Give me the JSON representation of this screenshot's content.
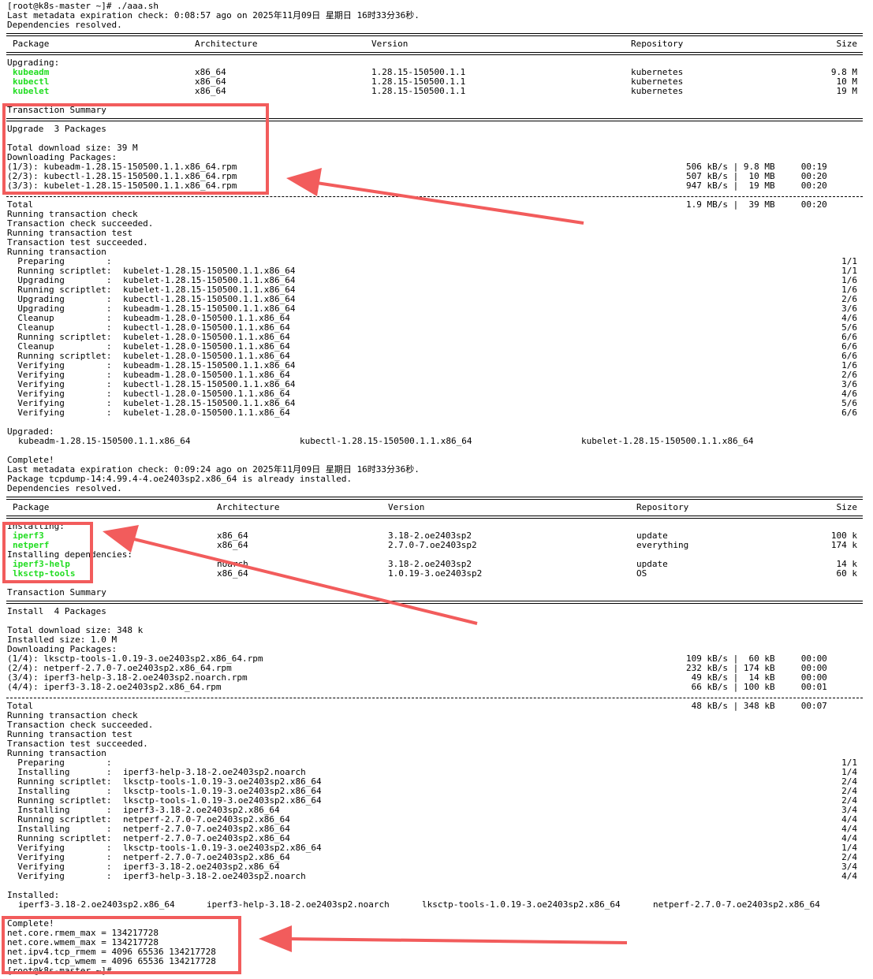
{
  "prompt": "[root@k8s-master ~]# ./aaa.sh",
  "meta1": "Last metadata expiration check: 0:08:57 ago on 2025年11月09日 星期日 16时33分36秒.",
  "deps_resolved": "Dependencies resolved.",
  "headers": {
    "package": "Package",
    "arch": "Architecture",
    "version": "Version",
    "repo": "Repository",
    "size": "Size"
  },
  "upgrading_label": "Upgrading:",
  "upgrade_pkgs": [
    {
      "name": "kubeadm",
      "arch": "x86_64",
      "version": "1.28.15-150500.1.1",
      "repo": "kubernetes",
      "size": "9.8 M"
    },
    {
      "name": "kubectl",
      "arch": "x86_64",
      "version": "1.28.15-150500.1.1",
      "repo": "kubernetes",
      "size": "10 M"
    },
    {
      "name": "kubelet",
      "arch": "x86_64",
      "version": "1.28.15-150500.1.1",
      "repo": "kubernetes",
      "size": "19 M"
    }
  ],
  "txn_summary": "Transaction Summary",
  "upgrade_count": "Upgrade  3 Packages",
  "total_dl1": "Total download size: 39 M",
  "downloading": "Downloading Packages:",
  "dl1": [
    {
      "file": "(1/3): kubeadm-1.28.15-150500.1.1.x86_64.rpm",
      "rate": "506 kB/s | 9.8 MB     00:19"
    },
    {
      "file": "(2/3): kubectl-1.28.15-150500.1.1.x86_64.rpm",
      "rate": "507 kB/s |  10 MB     00:20"
    },
    {
      "file": "(3/3): kubelet-1.28.15-150500.1.1.x86_64.rpm",
      "rate": "947 kB/s |  19 MB     00:20"
    }
  ],
  "total_label": "Total",
  "total1_rate": "1.9 MB/s |  39 MB     00:20",
  "txn_lines": [
    "Running transaction check",
    "Transaction check succeeded.",
    "Running transaction test",
    "Transaction test succeeded.",
    "Running transaction"
  ],
  "steps1": [
    {
      "action": "  Preparing        :",
      "pkg": "",
      "prog": "1/1"
    },
    {
      "action": "  Running scriptlet:",
      "pkg": "kubelet-1.28.15-150500.1.1.x86_64",
      "prog": "1/1"
    },
    {
      "action": "  Upgrading        :",
      "pkg": "kubelet-1.28.15-150500.1.1.x86_64",
      "prog": "1/6"
    },
    {
      "action": "  Running scriptlet:",
      "pkg": "kubelet-1.28.15-150500.1.1.x86_64",
      "prog": "1/6"
    },
    {
      "action": "  Upgrading        :",
      "pkg": "kubectl-1.28.15-150500.1.1.x86_64",
      "prog": "2/6"
    },
    {
      "action": "  Upgrading        :",
      "pkg": "kubeadm-1.28.15-150500.1.1.x86_64",
      "prog": "3/6"
    },
    {
      "action": "  Cleanup          :",
      "pkg": "kubeadm-1.28.0-150500.1.1.x86_64",
      "prog": "4/6"
    },
    {
      "action": "  Cleanup          :",
      "pkg": "kubectl-1.28.0-150500.1.1.x86_64",
      "prog": "5/6"
    },
    {
      "action": "  Running scriptlet:",
      "pkg": "kubelet-1.28.0-150500.1.1.x86_64",
      "prog": "6/6"
    },
    {
      "action": "  Cleanup          :",
      "pkg": "kubelet-1.28.0-150500.1.1.x86_64",
      "prog": "6/6"
    },
    {
      "action": "  Running scriptlet:",
      "pkg": "kubelet-1.28.0-150500.1.1.x86_64",
      "prog": "6/6"
    },
    {
      "action": "  Verifying        :",
      "pkg": "kubeadm-1.28.15-150500.1.1.x86_64",
      "prog": "1/6"
    },
    {
      "action": "  Verifying        :",
      "pkg": "kubeadm-1.28.0-150500.1.1.x86_64",
      "prog": "2/6"
    },
    {
      "action": "  Verifying        :",
      "pkg": "kubectl-1.28.15-150500.1.1.x86_64",
      "prog": "3/6"
    },
    {
      "action": "  Verifying        :",
      "pkg": "kubectl-1.28.0-150500.1.1.x86_64",
      "prog": "4/6"
    },
    {
      "action": "  Verifying        :",
      "pkg": "kubelet-1.28.15-150500.1.1.x86_64",
      "prog": "5/6"
    },
    {
      "action": "  Verifying        :",
      "pkg": "kubelet-1.28.0-150500.1.1.x86_64",
      "prog": "6/6"
    }
  ],
  "upgraded_label": "Upgraded:",
  "upgraded": [
    "kubeadm-1.28.15-150500.1.1.x86_64",
    "kubectl-1.28.15-150500.1.1.x86_64",
    "kubelet-1.28.15-150500.1.1.x86_64"
  ],
  "complete": "Complete!",
  "meta2": "Last metadata expiration check: 0:09:24 ago on 2025年11月09日 星期日 16时33分36秒.",
  "tcpdump": "Package tcpdump-14:4.99.4-4.oe2403sp2.x86_64 is already installed.",
  "installing_label": "Installing:",
  "install_pkgs": [
    {
      "name": "iperf3",
      "arch": "x86_64",
      "version": "3.18-2.oe2403sp2",
      "repo": "update",
      "size": "100 k"
    },
    {
      "name": "netperf",
      "arch": "x86_64",
      "version": "2.7.0-7.oe2403sp2",
      "repo": "everything",
      "size": "174 k"
    }
  ],
  "installing_deps_label": "Installing dependencies:",
  "dep_pkgs": [
    {
      "name": "iperf3-help",
      "arch": "noarch",
      "version": "3.18-2.oe2403sp2",
      "repo": "update",
      "size": "14 k"
    },
    {
      "name": "lksctp-tools",
      "arch": "x86_64",
      "version": "1.0.19-3.oe2403sp2",
      "repo": "OS",
      "size": "60 k"
    }
  ],
  "install_count": "Install  4 Packages",
  "total_dl2": "Total download size: 348 k",
  "installed_size": "Installed size: 1.0 M",
  "dl2": [
    {
      "file": "(1/4): lksctp-tools-1.0.19-3.oe2403sp2.x86_64.rpm",
      "rate": "109 kB/s |  60 kB     00:00"
    },
    {
      "file": "(2/4): netperf-2.7.0-7.oe2403sp2.x86_64.rpm",
      "rate": "232 kB/s | 174 kB     00:00"
    },
    {
      "file": "(3/4): iperf3-help-3.18-2.oe2403sp2.noarch.rpm",
      "rate": " 49 kB/s |  14 kB     00:00"
    },
    {
      "file": "(4/4): iperf3-3.18-2.oe2403sp2.x86_64.rpm",
      "rate": " 66 kB/s | 100 kB     00:01"
    }
  ],
  "total2_rate": " 48 kB/s | 348 kB     00:07",
  "steps2": [
    {
      "action": "  Preparing        :",
      "pkg": "",
      "prog": "1/1"
    },
    {
      "action": "  Installing       :",
      "pkg": "iperf3-help-3.18-2.oe2403sp2.noarch",
      "prog": "1/4"
    },
    {
      "action": "  Running scriptlet:",
      "pkg": "lksctp-tools-1.0.19-3.oe2403sp2.x86_64",
      "prog": "2/4"
    },
    {
      "action": "  Installing       :",
      "pkg": "lksctp-tools-1.0.19-3.oe2403sp2.x86_64",
      "prog": "2/4"
    },
    {
      "action": "  Running scriptlet:",
      "pkg": "lksctp-tools-1.0.19-3.oe2403sp2.x86_64",
      "prog": "2/4"
    },
    {
      "action": "  Installing       :",
      "pkg": "iperf3-3.18-2.oe2403sp2.x86_64",
      "prog": "3/4"
    },
    {
      "action": "  Running scriptlet:",
      "pkg": "netperf-2.7.0-7.oe2403sp2.x86_64",
      "prog": "4/4"
    },
    {
      "action": "  Installing       :",
      "pkg": "netperf-2.7.0-7.oe2403sp2.x86_64",
      "prog": "4/4"
    },
    {
      "action": "  Running scriptlet:",
      "pkg": "netperf-2.7.0-7.oe2403sp2.x86_64",
      "prog": "4/4"
    },
    {
      "action": "  Verifying        :",
      "pkg": "lksctp-tools-1.0.19-3.oe2403sp2.x86_64",
      "prog": "1/4"
    },
    {
      "action": "  Verifying        :",
      "pkg": "netperf-2.7.0-7.oe2403sp2.x86_64",
      "prog": "2/4"
    },
    {
      "action": "  Verifying        :",
      "pkg": "iperf3-3.18-2.oe2403sp2.x86_64",
      "prog": "3/4"
    },
    {
      "action": "  Verifying        :",
      "pkg": "iperf3-help-3.18-2.oe2403sp2.noarch",
      "prog": "4/4"
    }
  ],
  "installed_label": "Installed:",
  "installed": [
    "iperf3-3.18-2.oe2403sp2.x86_64",
    "iperf3-help-3.18-2.oe2403sp2.noarch",
    "lksctp-tools-1.0.19-3.oe2403sp2.x86_64",
    "netperf-2.7.0-7.oe2403sp2.x86_64"
  ],
  "sysctl": [
    "net.core.rmem_max = 134217728",
    "net.core.wmem_max = 134217728",
    "net.ipv4.tcp_rmem = 4096 65536 134217728",
    "net.ipv4.tcp_wmem = 4096 65536 134217728"
  ],
  "final_prompt": "[root@k8s-master ~]# ",
  "colors": {
    "package_name": "#22dd22",
    "annotation": "#f25c5c"
  },
  "icons": {
    "annotation_arrow": "red-arrow-icon"
  }
}
